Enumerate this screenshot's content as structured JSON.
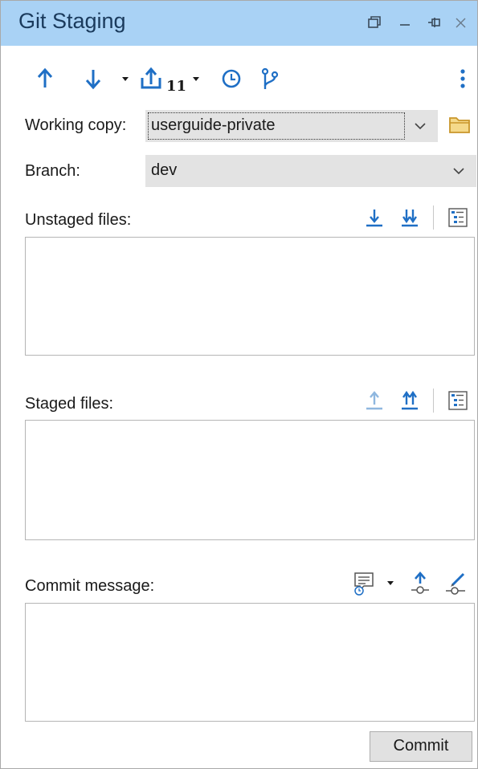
{
  "window": {
    "title": "Git Staging"
  },
  "toolbar": {
    "icons": [
      "push-icon",
      "pull-icon",
      "stash-icon",
      "history-icon",
      "branch-icon",
      "more-icon"
    ],
    "stash_count": "11"
  },
  "working_copy": {
    "label": "Working copy:",
    "value": "userguide-private"
  },
  "branch": {
    "label": "Branch:",
    "value": "dev"
  },
  "unstaged": {
    "label": "Unstaged files:"
  },
  "staged": {
    "label": "Staged files:"
  },
  "commit": {
    "label": "Commit message:",
    "button_label": "Commit"
  },
  "colors": {
    "titlebar_bg": "#a9d2f5",
    "accent_blue": "#1f6fc5",
    "folder_yellow": "#e6b84a"
  }
}
